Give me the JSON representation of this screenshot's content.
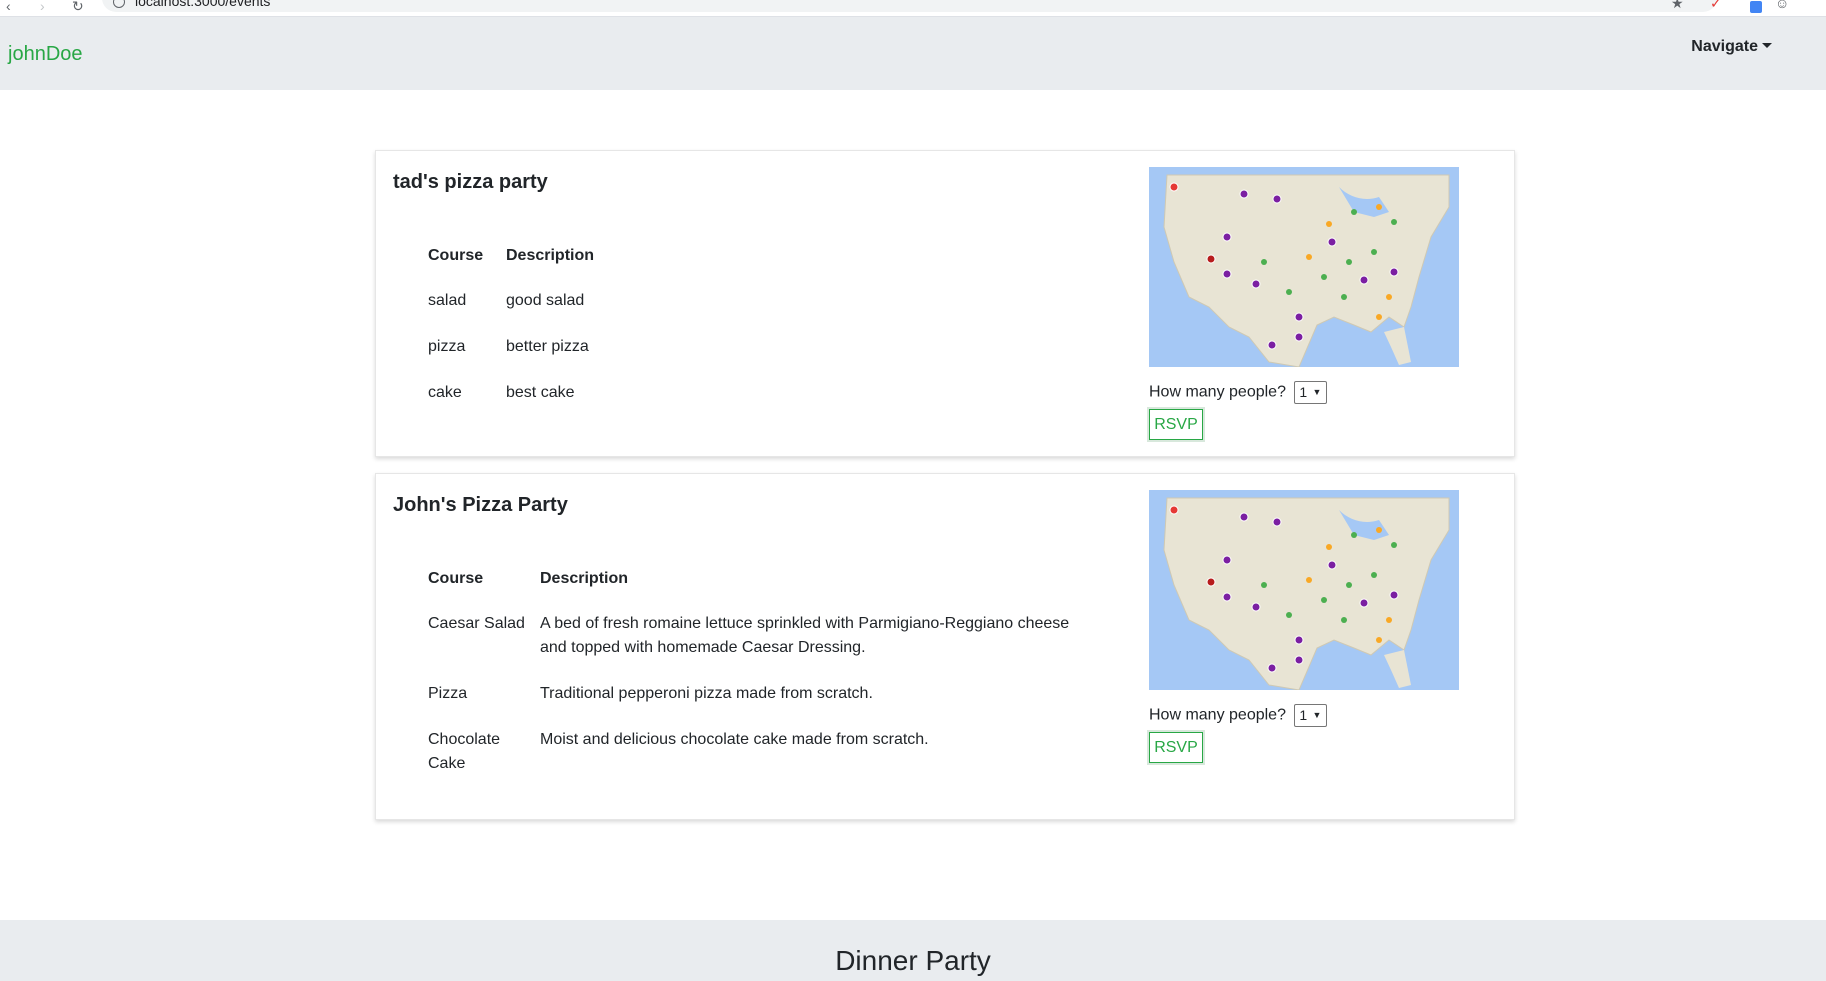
{
  "browser": {
    "url": "localhost:3000/events",
    "back_icon": "back-arrow-icon",
    "forward_icon": "forward-arrow-icon",
    "reload_icon": "reload-icon"
  },
  "navbar": {
    "brand": "johnDoe",
    "navigate_label": "Navigate"
  },
  "events": [
    {
      "title": "tad's pizza party",
      "menu_headers": {
        "course": "Course",
        "description": "Description"
      },
      "menu": [
        {
          "course": "salad",
          "description": "good salad"
        },
        {
          "course": "pizza",
          "description": "better pizza"
        },
        {
          "course": "cake",
          "description": "best cake"
        }
      ],
      "people_label": "How many people?",
      "people_value": "1",
      "rsvp_label": "RSVP"
    },
    {
      "title": "John's Pizza Party",
      "menu_headers": {
        "course": "Course",
        "description": "Description"
      },
      "menu": [
        {
          "course": "Caesar Salad",
          "description": "A bed of fresh romaine lettuce sprinkled with Parmigiano-Reggiano cheese and topped with homemade Caesar Dressing."
        },
        {
          "course": "Pizza",
          "description": "Traditional pepperoni pizza made from scratch."
        },
        {
          "course": "Chocolate Cake",
          "description": "Moist and delicious chocolate cake made from scratch."
        }
      ],
      "people_label": "How many people?",
      "people_value": "1",
      "rsvp_label": "RSVP"
    }
  ],
  "footer": {
    "title": "Dinner Party"
  },
  "colors": {
    "accent": "#28a745",
    "navbar_bg": "#e9ecef",
    "map_water": "#a5c8f5",
    "map_land": "#e8e4d4"
  }
}
